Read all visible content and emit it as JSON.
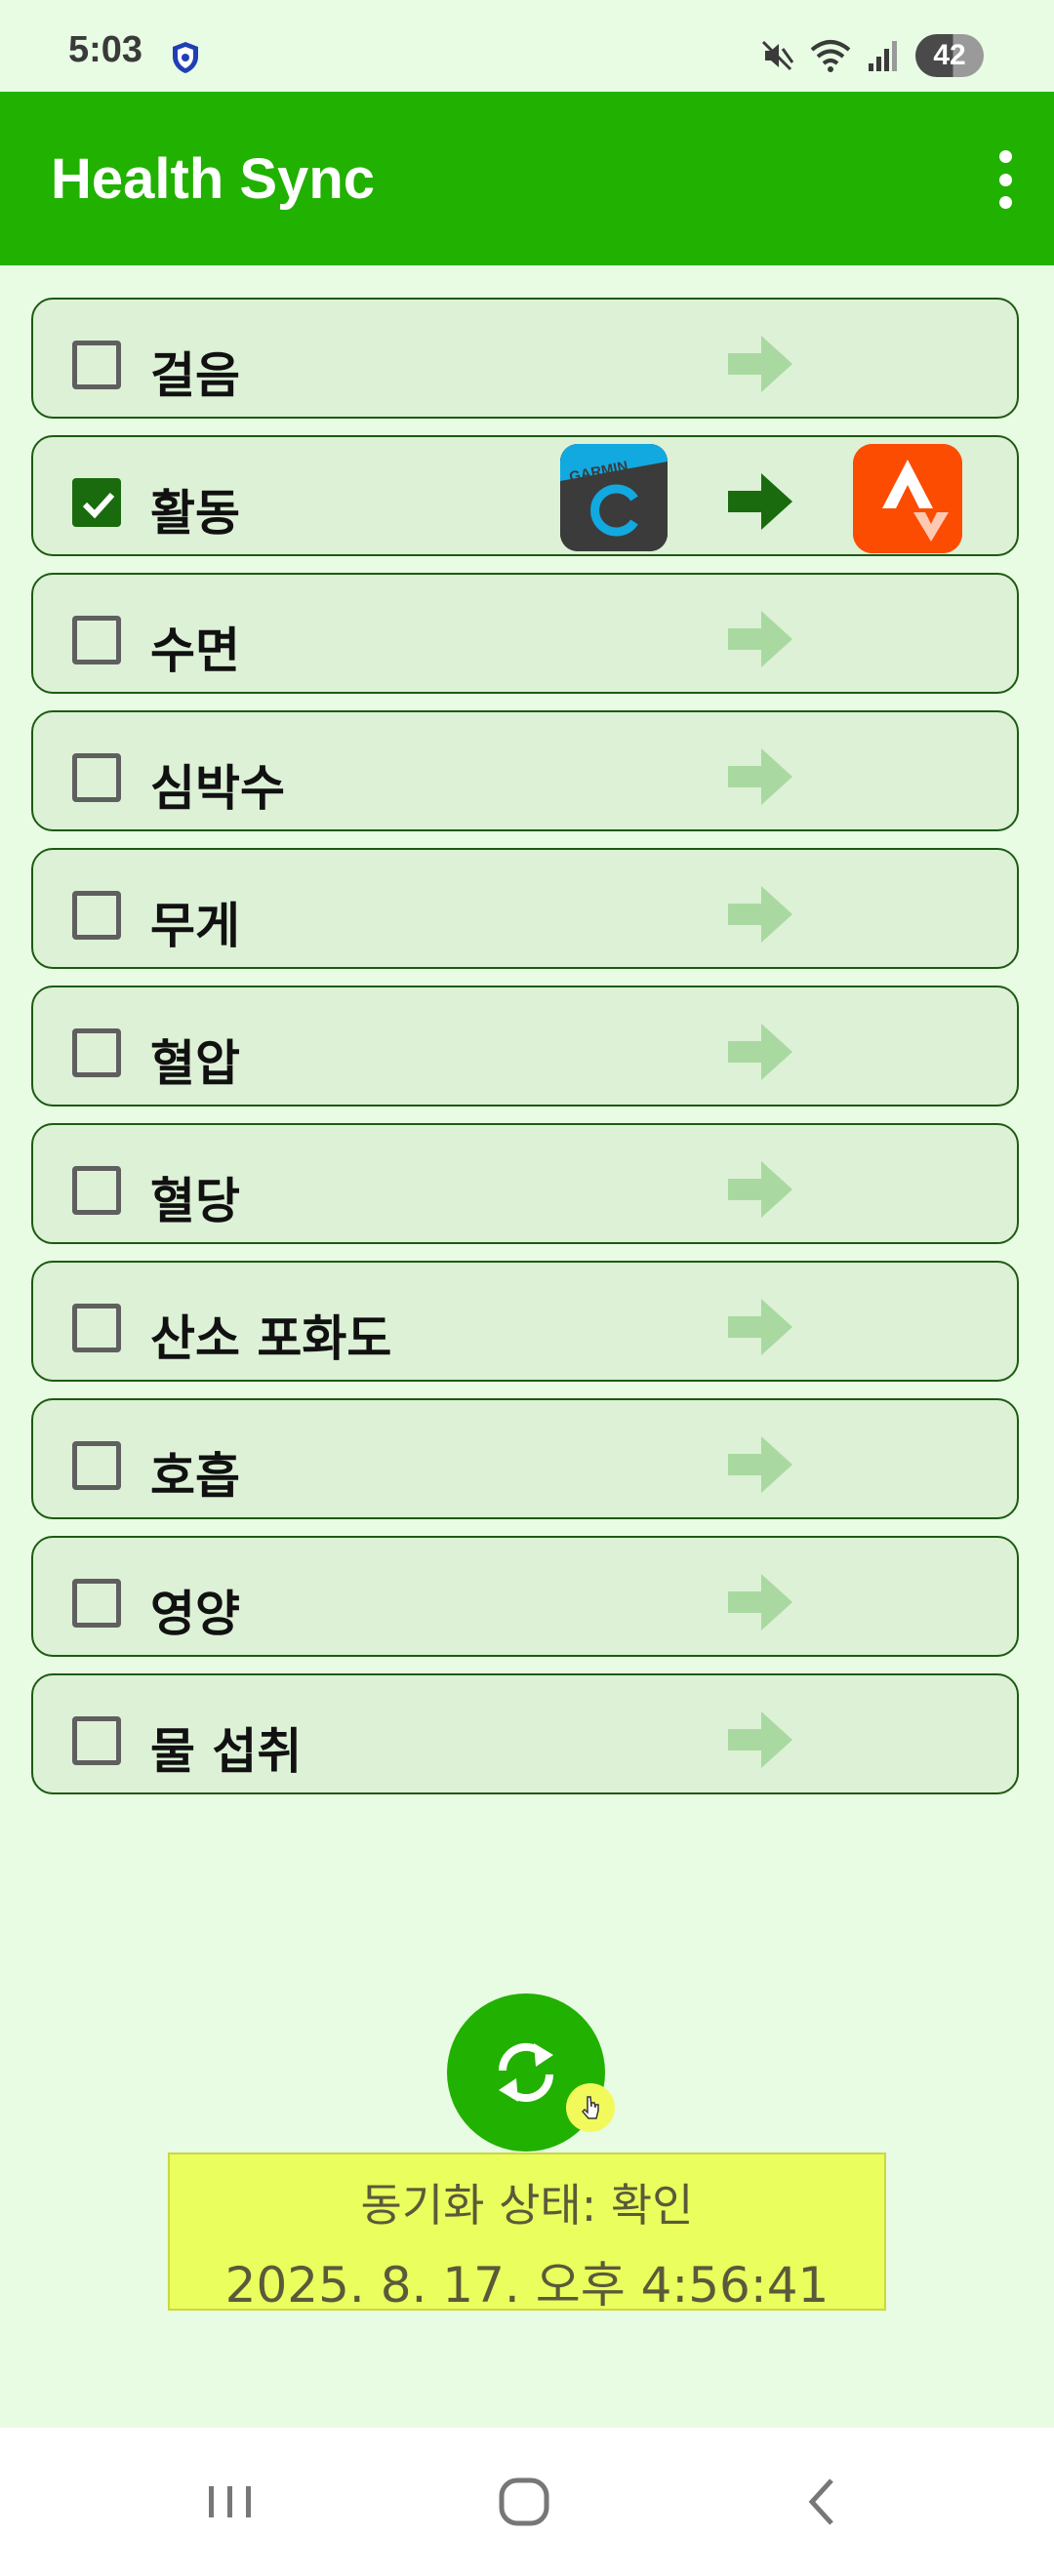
{
  "status_bar": {
    "time": "5:03",
    "battery_level": "42",
    "icons": [
      "shield-icon",
      "mute-icon",
      "wifi-icon",
      "signal-icon",
      "battery-icon"
    ]
  },
  "app_bar": {
    "title": "Health Sync",
    "menu_icon": "overflow-menu-icon"
  },
  "colors": {
    "app_bar": "#21b100",
    "background": "#e8fbe3",
    "row_bg": "#dcf1d6",
    "row_border": "#1d5a12",
    "checked": "#1a6b0e",
    "arrow_active": "#1a6b0e",
    "arrow_inactive": "#a9d9a0",
    "status_box": "#eaff5e"
  },
  "items": [
    {
      "label": "걸음",
      "checked": false
    },
    {
      "label": "활동",
      "checked": true,
      "source_app": "Garmin Connect",
      "source_logo_text": "GARMIN",
      "destination_app": "Strava"
    },
    {
      "label": "수면",
      "checked": false
    },
    {
      "label": "심박수",
      "checked": false
    },
    {
      "label": "무게",
      "checked": false
    },
    {
      "label": "혈압",
      "checked": false
    },
    {
      "label": "혈당",
      "checked": false
    },
    {
      "label": "산소 포화도",
      "checked": false
    },
    {
      "label": "호흡",
      "checked": false
    },
    {
      "label": "영양",
      "checked": false
    },
    {
      "label": "물 섭취",
      "checked": false
    }
  ],
  "sync": {
    "button_icon": "sync-icon",
    "status_line": "동기화 상태: 확인",
    "timestamp": "2025. 8. 17. 오후 4:56:41"
  },
  "nav_bar": {
    "buttons": [
      "recent-apps-icon",
      "home-icon",
      "back-icon"
    ]
  }
}
